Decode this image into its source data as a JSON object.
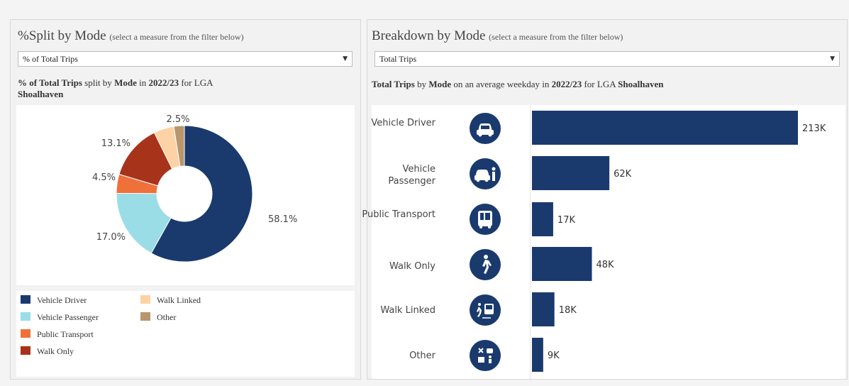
{
  "left": {
    "title": "%Split by Mode",
    "title_note": "(select a measure from the filter below)",
    "filter_value": "% of Total Trips",
    "subtitle": {
      "measure": "% of Total Trips",
      "t1": " split by ",
      "mode": "Mode",
      "t2": " in ",
      "year": "2022/23",
      "t3": " for LGA ",
      "lga": "Shoalhaven"
    },
    "legend": [
      {
        "label": "Vehicle Driver",
        "color": "#1a3a6e"
      },
      {
        "label": "Vehicle Passenger",
        "color": "#9adde6"
      },
      {
        "label": "Public Transport",
        "color": "#f0703a"
      },
      {
        "label": "Walk Only",
        "color": "#a8331b"
      },
      {
        "label": "Walk Linked",
        "color": "#fdd2a4"
      },
      {
        "label": "Other",
        "color": "#b8966e"
      }
    ]
  },
  "right": {
    "title": "Breakdown by Mode",
    "title_note": "(select a measure from the filter below)",
    "filter_value": "Total Trips",
    "subtitle": {
      "measure": "Total Trips",
      "t1": " by ",
      "mode": "Mode",
      "t2": " on an average weekday in ",
      "year": "2022/23",
      "t3": " for LGA ",
      "lga": "Shoalhaven"
    },
    "rows": [
      {
        "label": "Vehicle Driver",
        "icon": "car-icon"
      },
      {
        "label": "Vehicle Passenger",
        "icon": "car-passenger-icon"
      },
      {
        "label": "Public Transport",
        "icon": "bus-icon"
      },
      {
        "label": "Walk Only",
        "icon": "walking-icon"
      },
      {
        "label": "Walk Linked",
        "icon": "walk-bus-icon"
      },
      {
        "label": "Other",
        "icon": "other-modes-icon"
      }
    ]
  },
  "chart_data": [
    {
      "type": "pie",
      "categories": [
        "Vehicle Driver",
        "Vehicle Passenger",
        "Public Transport",
        "Walk Only",
        "Walk Linked",
        "Other"
      ],
      "values": [
        58.1,
        17.0,
        4.5,
        13.1,
        4.8,
        2.5
      ],
      "data_labels": [
        "58.1%",
        "17.0%",
        "4.5%",
        "13.1%",
        "",
        "2.5%"
      ],
      "colors": [
        "#1a3a6e",
        "#9adde6",
        "#f0703a",
        "#a8331b",
        "#fdd2a4",
        "#b8966e"
      ],
      "donut": true,
      "legend_position": "bottom"
    },
    {
      "type": "bar",
      "orientation": "horizontal",
      "categories": [
        "Vehicle Driver",
        "Vehicle Passenger",
        "Public Transport",
        "Walk Only",
        "Walk Linked",
        "Other"
      ],
      "values": [
        213000,
        62000,
        17000,
        48000,
        18000,
        9000
      ],
      "data_labels": [
        "213K",
        "62K",
        "17K",
        "48K",
        "18K",
        "9K"
      ],
      "color": "#1a3a6e",
      "grid": false
    }
  ]
}
